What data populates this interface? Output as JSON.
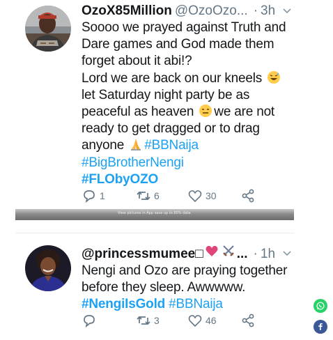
{
  "tweets": [
    {
      "display_name": "OzoX85Million",
      "handle": "@OzoOzo...",
      "dot": "·",
      "time": "3h",
      "lines": [
        "Soooo we prayed against Truth and",
        "Dare games and God made them",
        "forget about it abi!?",
        "Lord we are back on our kneels",
        "let Saturday night party be as",
        "peaceful as heaven",
        "we are not",
        "ready to get dragged or to drag",
        "anyone"
      ],
      "hashtags": [
        "#BBNaija",
        "#BigBrotherNengi",
        "#FLObyOZO"
      ],
      "replies": "1",
      "retweets": "6",
      "likes": "30"
    },
    {
      "display_name": "@princessmumee",
      "display_name_box": "□",
      "dot": "·",
      "time": "1h",
      "lines": [
        "Nengi and Ozo are praying together",
        "before they sleep. Awwwww."
      ],
      "hashtags": [
        "#NengiIsGold",
        "#BBNaija"
      ],
      "replies": "",
      "retweets": "3",
      "likes": "46"
    }
  ],
  "ad_bar": {
    "text": "View pictures in App save up to 80% data."
  },
  "colors": {
    "hashtag": "#1da1f2",
    "meta": "#657786",
    "whatsapp": "#25d366",
    "facebook": "#3b5998"
  },
  "icons": {
    "emoji_1": "grinning-sweat-emoji",
    "emoji_2": "expressionless-face-emoji",
    "emoji_3": "folded-hands-emoji",
    "emoji_4": "heart-emoji",
    "emoji_5": "crossed-swords-emoji"
  }
}
